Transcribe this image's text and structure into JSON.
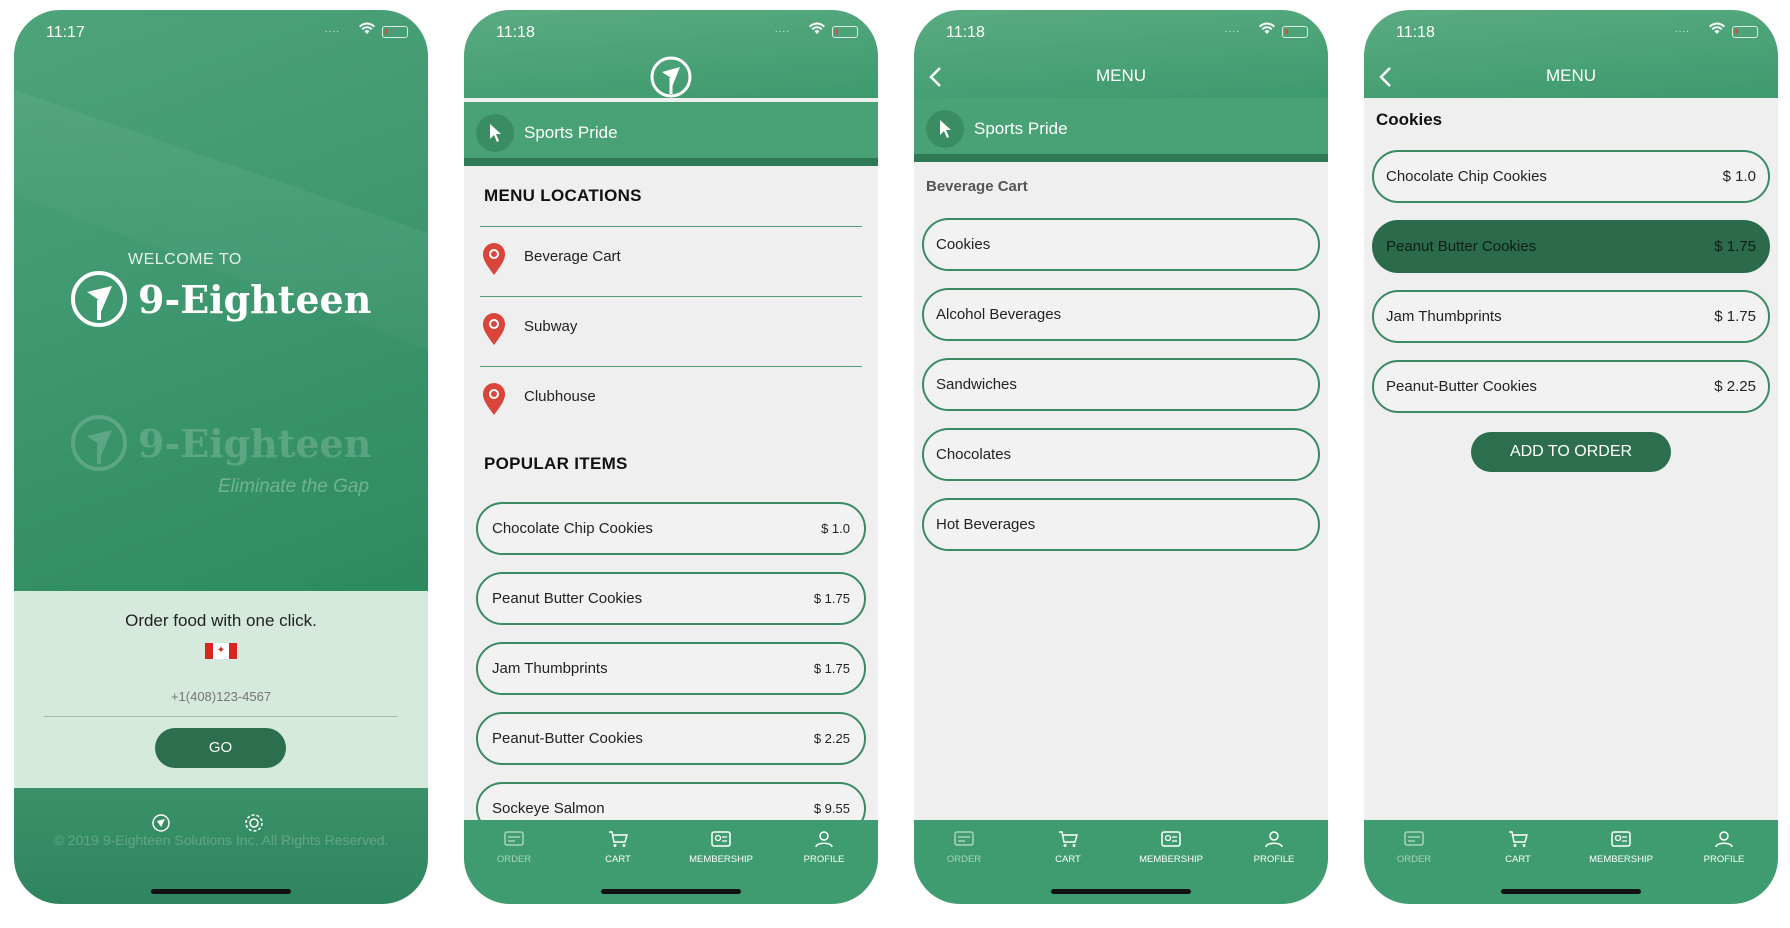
{
  "colors": {
    "primary_green": "#3f9b70",
    "dark_green": "#2c6e4d",
    "pin_red": "#d9443b"
  },
  "status_bar": {
    "battery_icon": "battery-low-icon",
    "wifi_icon": "wifi-icon",
    "signal": "...."
  },
  "screens": [
    {
      "time": "11:17",
      "welcome": "WELCOME TO",
      "brand": "9-Eighteen",
      "tagline": "Eliminate the Gap",
      "order_prompt": "Order food with one click.",
      "country_flag_icon": "canada-flag-icon",
      "phone_placeholder": "+1(408)123-4567",
      "go_label": "GO",
      "copyright": "© 2019 9-Eighteen Solutions Inc. All Rights Reserved."
    },
    {
      "time": "11:18",
      "venue": "Sports Pride",
      "menu_locations_title": "MENU LOCATIONS",
      "locations": [
        "Beverage Cart",
        "Subway",
        "Clubhouse"
      ],
      "popular_title": "POPULAR ITEMS",
      "popular_items": [
        {
          "name": "Chocolate Chip Cookies",
          "price": "$ 1.0"
        },
        {
          "name": "Peanut Butter Cookies",
          "price": "$ 1.75"
        },
        {
          "name": "Jam Thumbprints",
          "price": "$ 1.75"
        },
        {
          "name": "Peanut-Butter Cookies",
          "price": "$ 2.25"
        },
        {
          "name": "Sockeye Salmon",
          "price": "$ 9.55"
        }
      ]
    },
    {
      "time": "11:18",
      "title": "MENU",
      "venue": "Sports Pride",
      "location": "Beverage Cart",
      "categories": [
        "Cookies",
        "Alcohol Beverages",
        "Sandwiches",
        "Chocolates",
        "Hot Beverages"
      ]
    },
    {
      "time": "11:18",
      "title": "MENU",
      "category": "Cookies",
      "items": [
        {
          "name": "Chocolate Chip Cookies",
          "price": "$ 1.0",
          "selected": false
        },
        {
          "name": "Peanut Butter Cookies",
          "price": "$ 1.75",
          "selected": true
        },
        {
          "name": "Jam Thumbprints",
          "price": "$ 1.75",
          "selected": false
        },
        {
          "name": "Peanut-Butter Cookies",
          "price": "$ 2.25",
          "selected": false
        }
      ],
      "add_label": "ADD TO ORDER"
    }
  ],
  "tabs": [
    "ORDER",
    "CART",
    "MEMBERSHIP",
    "PROFILE"
  ]
}
